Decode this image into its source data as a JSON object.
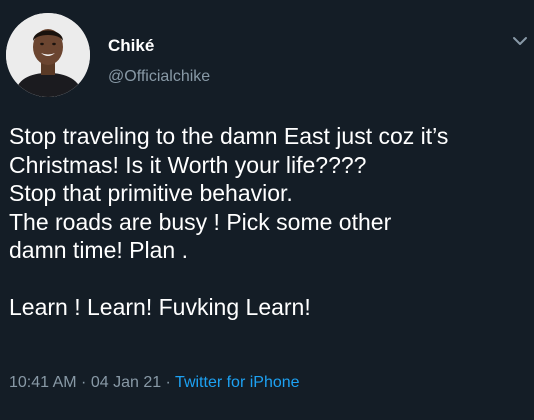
{
  "tweet": {
    "author": {
      "name": "Chiké",
      "handle": "@Officialchike"
    },
    "lines": [
      "Stop traveling to the damn East just coz it’s",
      "Christmas! Is it Worth your life????",
      "Stop that primitive behavior.",
      "The roads are busy ! Pick some other",
      "damn time! Plan .",
      "Learn ! Learn! Fuvking Learn!"
    ],
    "time": "10:41 AM",
    "separator": " · ",
    "date": "04 Jan 21",
    "source": "Twitter for iPhone"
  },
  "icons": {
    "menu": "chevron-down-icon"
  },
  "colors": {
    "background": "#141d26",
    "text": "#ffffff",
    "muted": "#8899a6",
    "link": "#1da1f2"
  }
}
